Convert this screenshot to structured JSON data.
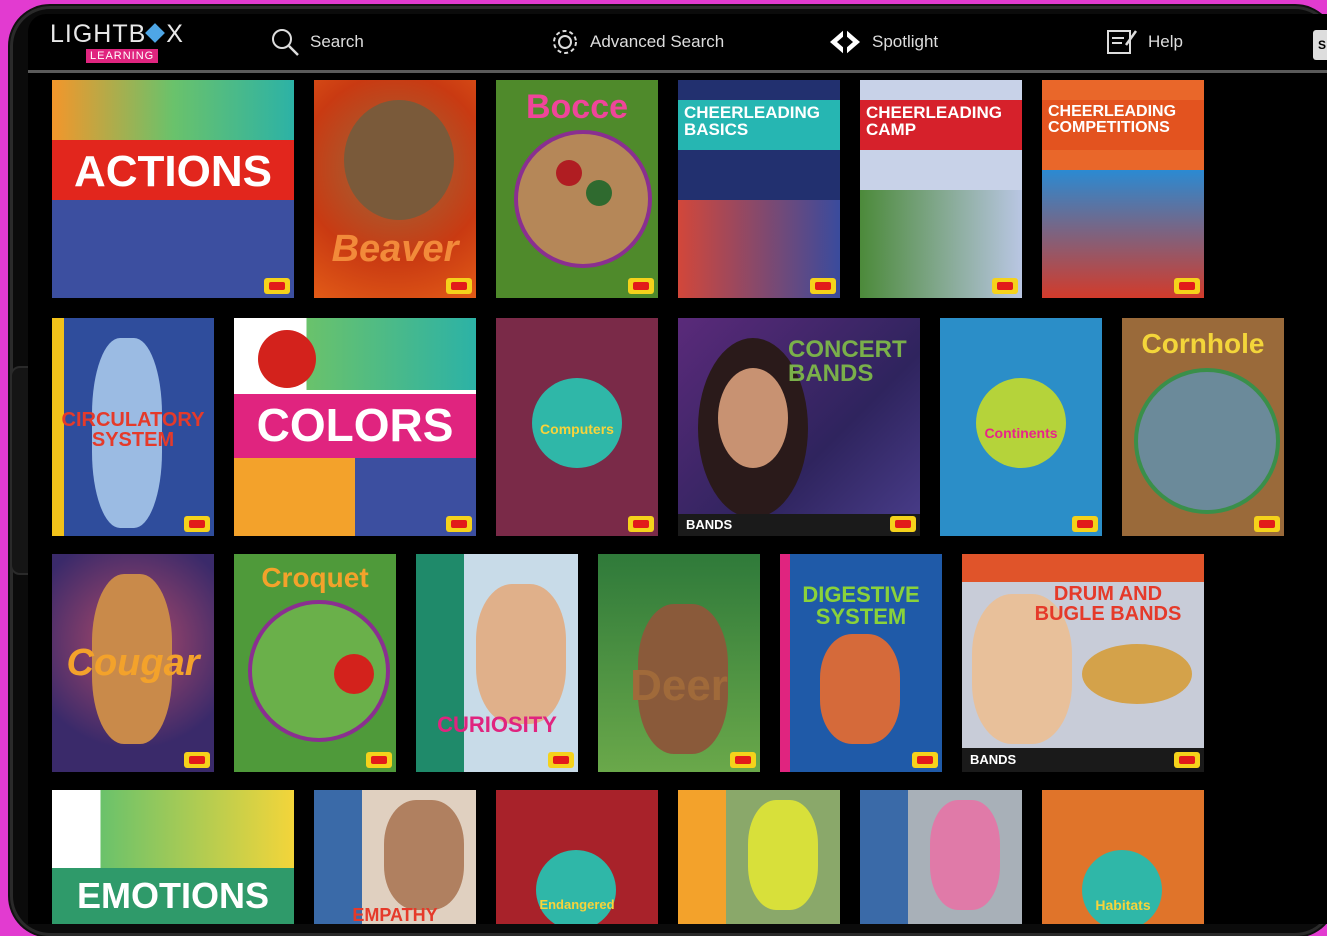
{
  "app": {
    "logo_main": "LIGHTB",
    "logo_tail": "X",
    "logo_sub": "LEARNING"
  },
  "nav": {
    "search": "Search",
    "advanced_search": "Advanced Search",
    "spotlight": "Spotlight",
    "help": "Help",
    "edge_icon": "S"
  },
  "books": [
    {
      "title": "ACTIONS"
    },
    {
      "title": "Beaver"
    },
    {
      "title": "Bocce"
    },
    {
      "title": "CHEERLEADING BASICS"
    },
    {
      "title": "CHEERLEADING CAMP"
    },
    {
      "title": "CHEERLEADING COMPETITIONS"
    },
    {
      "title": "CIRCULATORY SYSTEM"
    },
    {
      "title": "COLORS"
    },
    {
      "title": "Computers"
    },
    {
      "title": "CONCERT BANDS",
      "series": "BANDS"
    },
    {
      "title": "Continents"
    },
    {
      "title": "Cornhole"
    },
    {
      "title": "Cougar"
    },
    {
      "title": "Croquet"
    },
    {
      "title": "CURIOSITY"
    },
    {
      "title": "Deer"
    },
    {
      "title": "DIGESTIVE SYSTEM"
    },
    {
      "title": "DRUM AND BUGLE BANDS",
      "series": "BANDS"
    },
    {
      "title": "EMOTIONS"
    },
    {
      "title": "EMPATHY"
    },
    {
      "title": "Endangered"
    },
    {
      "title": ""
    },
    {
      "title": ""
    },
    {
      "title": "Habitats"
    }
  ],
  "colors": {
    "background": "#e23bd0",
    "screen": "#000000",
    "logo_accent": "#e0257f"
  },
  "icons": [
    "search-icon",
    "gear-icon",
    "spotlight-icon",
    "help-icon"
  ]
}
